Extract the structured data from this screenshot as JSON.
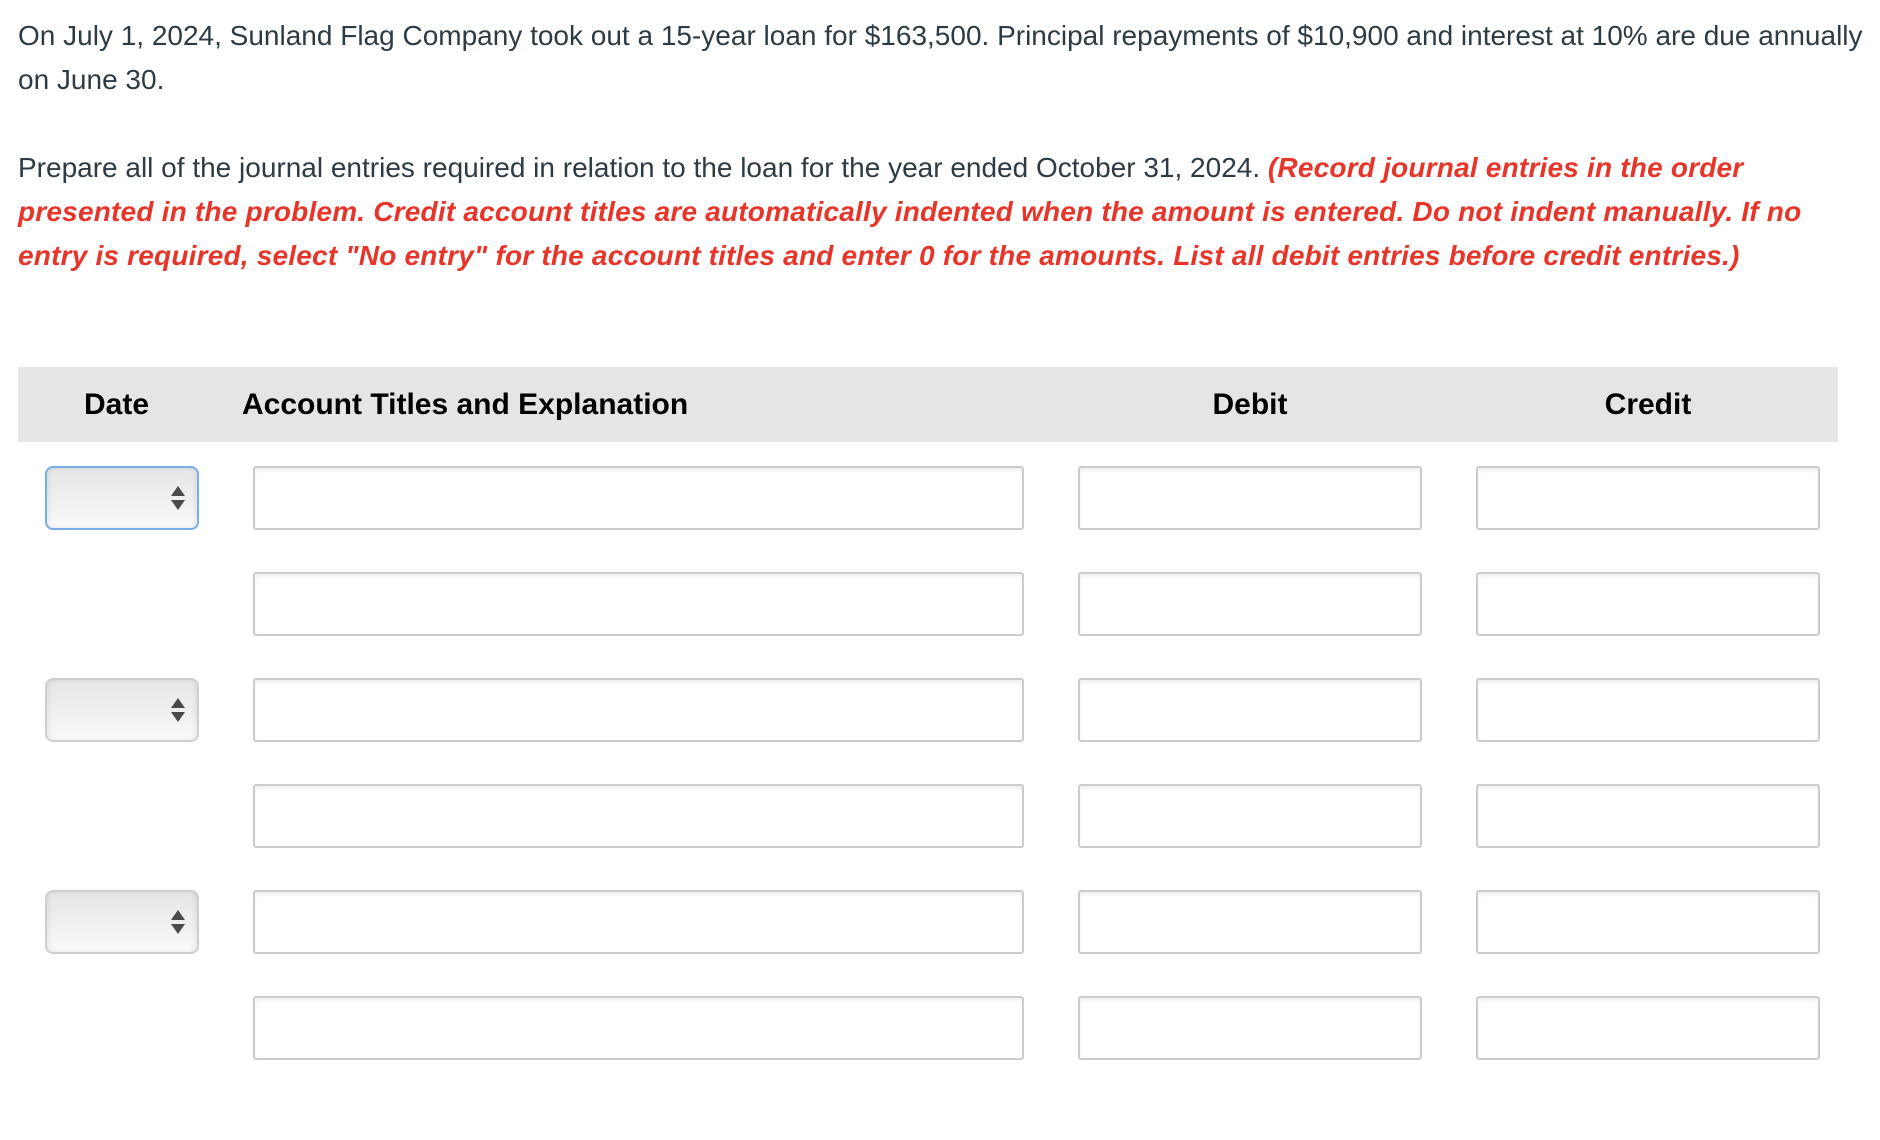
{
  "problem": {
    "text": "On July 1, 2024, Sunland Flag Company took out a 15-year loan for $163,500. Principal repayments of $10,900 and interest at 10% are due annually on June 30."
  },
  "instructions": {
    "text": "Prepare all of the journal entries required in relation to the loan for the year ended October 31, 2024.",
    "note": "(Record journal entries in the order presented in the problem. Credit account titles are automatically indented when the amount is entered. Do not indent manually. If no entry is required, select \"No entry\" for the account titles and enter 0 for the amounts. List all debit entries before credit entries.)"
  },
  "table": {
    "headers": {
      "date": "Date",
      "account": "Account Titles and Explanation",
      "debit": "Debit",
      "credit": "Credit"
    },
    "rows": [
      {
        "has_date": true,
        "date": "",
        "account": "",
        "debit": "",
        "credit": "",
        "date_focused": true
      },
      {
        "has_date": false,
        "account": "",
        "debit": "",
        "credit": ""
      },
      {
        "has_date": true,
        "date": "",
        "account": "",
        "debit": "",
        "credit": ""
      },
      {
        "has_date": false,
        "account": "",
        "debit": "",
        "credit": ""
      },
      {
        "has_date": true,
        "date": "",
        "account": "",
        "debit": "",
        "credit": ""
      },
      {
        "has_date": false,
        "account": "",
        "debit": "",
        "credit": ""
      }
    ]
  },
  "colors": {
    "body_text": "#2d3b45",
    "note_text": "#e8352a",
    "header_bg": "#e5e5e5",
    "focus_border": "#7aaee6"
  }
}
